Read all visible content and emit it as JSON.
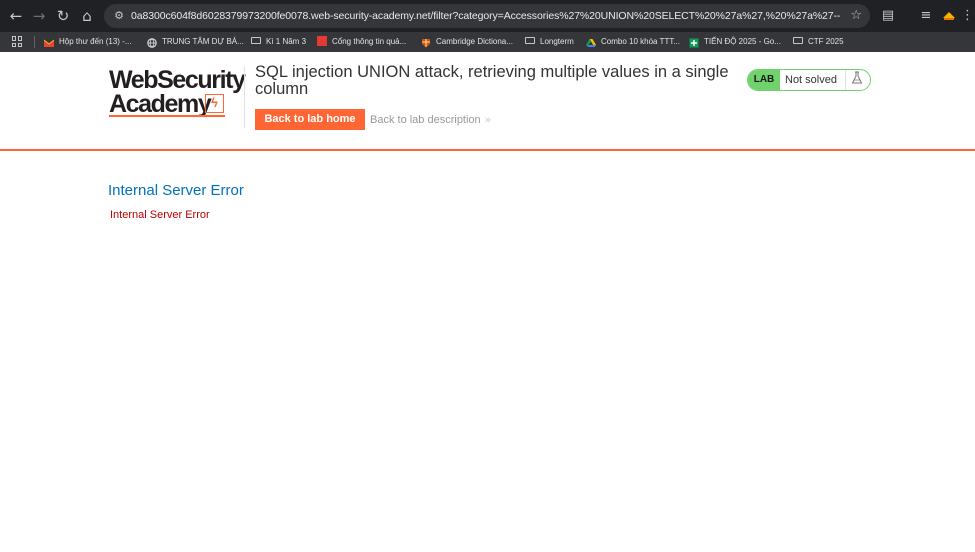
{
  "browser": {
    "url": "0a8300c604f8d6028379973200fe0078.web-security-academy.net/filter?category=Accessories%27%20UNION%20SELECT%20%27a%27,%20%27a%27--",
    "icons": {
      "back": "arrow-left-icon",
      "forward": "arrow-right-icon",
      "reload": "reload-icon",
      "home": "home-icon",
      "site_info": "tune-icon",
      "bookmark": "star-icon",
      "extensions": "puzzle-icon",
      "reading_list": "reading-list-icon",
      "profile": "profile-icon",
      "menu": "kebab-menu-icon"
    },
    "bookmarks": [
      {
        "label": "Hộp thư đến (13) -...",
        "icon": "gmail-icon"
      },
      {
        "label": "TRUNG TÂM DỰ BÁ...",
        "icon": "globe-icon"
      },
      {
        "label": "Kì 1 Năm 3",
        "icon": "folder-icon"
      },
      {
        "label": "Cổng thông tin quả...",
        "icon": "portal-icon"
      },
      {
        "label": "Cambridge Dictiona...",
        "icon": "cambridge-icon"
      },
      {
        "label": "Longterm",
        "icon": "folder-icon"
      },
      {
        "label": "Combo 10 khóa TTT...",
        "icon": "drive-icon"
      },
      {
        "label": "TIẾN ĐỘ 2025 - Go...",
        "icon": "sheets-icon"
      },
      {
        "label": "CTF 2025",
        "icon": "folder-icon"
      }
    ]
  },
  "header": {
    "logo_line1": "WebSecurity",
    "logo_line2": "Academy",
    "lab_title": "SQL injection UNION attack, retrieving multiple values in a single column",
    "back_home_label": "Back to lab home",
    "back_description_label": "Back to lab description",
    "status_tag": "LAB",
    "status_text": "Not solved"
  },
  "main": {
    "error_heading": "Internal Server Error",
    "error_message": "Internal Server Error"
  },
  "colors": {
    "accent": "#ff6633",
    "status_green": "#70d16d",
    "heading_blue": "#0071bc",
    "error_red": "#bb0000"
  }
}
